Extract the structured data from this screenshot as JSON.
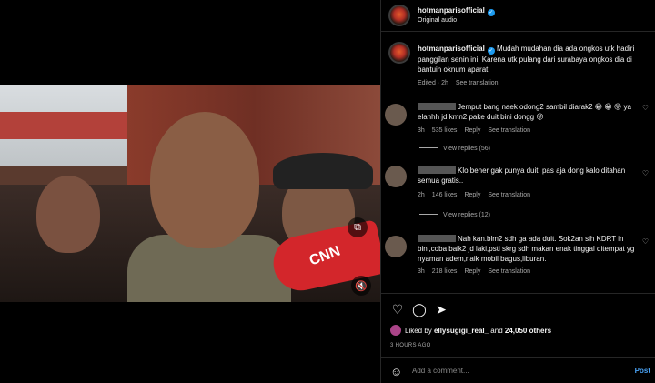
{
  "post": {
    "username": "hotmanparisofficial",
    "audio": "Original audio",
    "caption": "Mudah mudahan dia ada ongkos utk hadiri panggilan senin ini! Karena utk pulang dari surabaya ongkos dia di bantuin oknum aparat",
    "edited": "Edited · 2h",
    "see_translation": "See translation"
  },
  "video": {
    "mic_text": "CNN"
  },
  "comments": [
    {
      "text": "Jemput bang naek odong2 sambil diarak2 😀 😀 😝 ya elahhh jd kmn2 pake duit bini dongg 😝",
      "time": "3h",
      "likes": "535 likes",
      "reply": "Reply",
      "translation": "See translation",
      "view_replies": "View replies (56)"
    },
    {
      "text": "Klo bener gak punya duit. pas aja dong kalo ditahan semua gratis..",
      "time": "2h",
      "likes": "146 likes",
      "reply": "Reply",
      "translation": "See translation",
      "view_replies": "View replies (12)"
    },
    {
      "text": "Nah kan.blm2 sdh ga ada duit. Sok2an sih KDRT in bini,coba baik2 jd laki,psti skrg sdh makan enak tinggal ditempat yg nyaman adem,naik mobil bagus,liburan.",
      "time": "3h",
      "likes": "218 likes",
      "reply": "Reply",
      "translation": "See translation"
    }
  ],
  "likes": {
    "liked_by": "Liked by",
    "user": "ellysugigi_real_",
    "and": "and",
    "others": "24,050 others"
  },
  "date": "3 HOURS AGO",
  "comment_box": {
    "placeholder": "Add a comment...",
    "post_label": "Post"
  },
  "icons": [
    "heart-icon",
    "comment-icon",
    "share-icon",
    "emoji-icon",
    "mute-icon",
    "tag-icon",
    "verified-icon"
  ]
}
